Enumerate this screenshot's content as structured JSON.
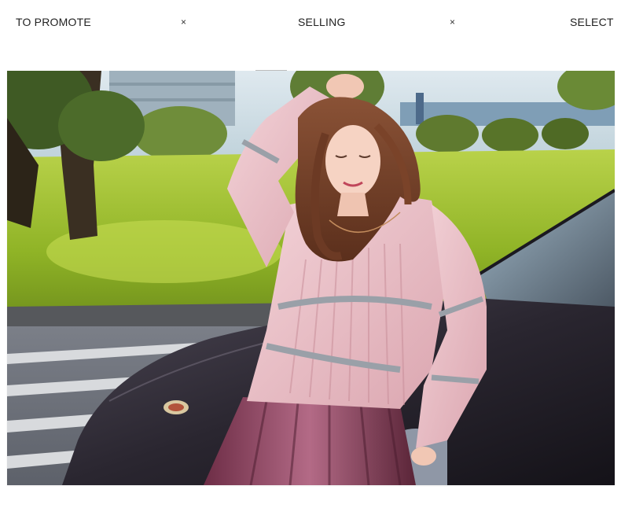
{
  "nav": {
    "items": [
      {
        "label": "TO PROMOTE"
      },
      {
        "label": "SELLING"
      },
      {
        "label": "SELECT"
      }
    ],
    "separator": "×"
  },
  "hero": {
    "icon": "fashion-model-photo"
  },
  "colors": {
    "background": "#ffffff",
    "text": "#222222",
    "sweater": "#e8b9c1",
    "stripe": "#9aa0a8",
    "car": "#2a2630",
    "grass": "#a7c62f",
    "skirt": "#8a3f5a"
  }
}
